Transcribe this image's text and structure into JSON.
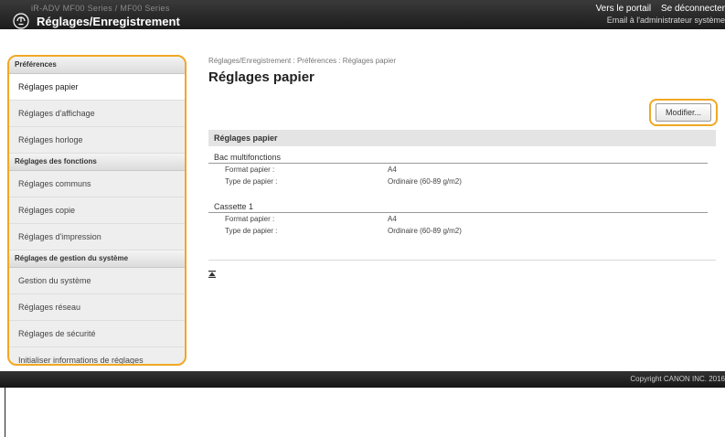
{
  "header": {
    "device_name": "iR-ADV  MF00 Series / MF00 Series",
    "portal_link": "Vers le portail",
    "logout_link": "Se déconnecter",
    "app_title": "Réglages/Enregistrement",
    "admin_mail": "Email à l'administrateur système"
  },
  "sidebar": {
    "sections": [
      {
        "title": "Préférences",
        "items": [
          "Réglages papier",
          "Réglages d'affichage",
          "Réglages horloge"
        ]
      },
      {
        "title": "Réglages des fonctions",
        "items": [
          "Réglages communs",
          "Réglages copie",
          "Réglages d'impression"
        ]
      },
      {
        "title": "Réglages de gestion du système",
        "items": [
          "Gestion du système",
          "Réglages réseau",
          "Réglages de sécurité",
          "Initialiser informations de réglages"
        ]
      }
    ],
    "active_item": "Réglages papier"
  },
  "main": {
    "breadcrumb": "Réglages/Enregistrement : Préférences : Réglages papier",
    "title": "Réglages papier",
    "modify_button": "Modifier...",
    "section_title": "Réglages papier",
    "groups": [
      {
        "title": "Bac multifonctions",
        "rows": [
          {
            "label": "Format papier :",
            "value": "A4"
          },
          {
            "label": "Type de papier :",
            "value": "Ordinaire (60-89 g/m2)"
          }
        ]
      },
      {
        "title": "Cassette 1",
        "rows": [
          {
            "label": "Format papier :",
            "value": "A4"
          },
          {
            "label": "Type de papier :",
            "value": "Ordinaire (60-89 g/m2)"
          }
        ]
      }
    ]
  },
  "footer": {
    "copyright": "Copyright CANON INC. 2016"
  },
  "colors": {
    "highlight": "#f0a823",
    "topbar": "#2b2b2b",
    "sidebar_bg": "#eeeeee"
  }
}
